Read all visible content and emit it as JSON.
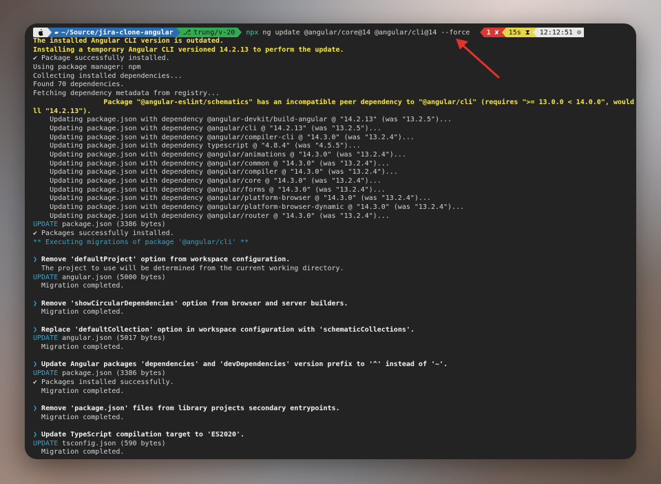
{
  "prompt": {
    "apple_icon": "",
    "folder_icon": "folder-icon",
    "dir": "~/Source/jira-clone-angular",
    "git_icon": "git-branch-icon",
    "branch": "trung/v-20",
    "cmd_npx": "npx",
    "cmd_rest": " ng update @angular/core@14 @angular/cli@14 --force"
  },
  "status": {
    "error": "1 ✘",
    "duration": "15s ⧗",
    "clock": "12:12:51 ⊙"
  },
  "lines": [
    {
      "t": "The installed Angular CLI version is outdated.",
      "c": "yellow bold"
    },
    {
      "t": "Installing a temporary Angular CLI versioned 14.2.13 to perform the update.",
      "c": "yellow bold"
    },
    {
      "t": "✔ Package successfully installed.",
      "c": ""
    },
    {
      "t": "Using package manager: npm",
      "c": ""
    },
    {
      "t": "Collecting installed dependencies...",
      "c": ""
    },
    {
      "t": "Found 70 dependencies.",
      "c": ""
    },
    {
      "t": "Fetching dependency metadata from registry...",
      "c": ""
    },
    {
      "t": "                 Package \"@angular-eslint/schematics\" has an incompatible peer dependency to \"@angular/cli\" (requires \">= 13.0.0 < 14.0.0\", would inst",
      "c": "yellow bold"
    },
    {
      "t": "ll \"14.2.13\").",
      "c": "yellow bold"
    },
    {
      "t": "    Updating package.json with dependency @angular-devkit/build-angular @ \"14.2.13\" (was \"13.2.5\")...",
      "c": ""
    },
    {
      "t": "    Updating package.json with dependency @angular/cli @ \"14.2.13\" (was \"13.2.5\")...",
      "c": ""
    },
    {
      "t": "    Updating package.json with dependency @angular/compiler-cli @ \"14.3.0\" (was \"13.2.4\")...",
      "c": ""
    },
    {
      "t": "    Updating package.json with dependency typescript @ \"4.8.4\" (was \"4.5.5\")...",
      "c": ""
    },
    {
      "t": "    Updating package.json with dependency @angular/animations @ \"14.3.0\" (was \"13.2.4\")...",
      "c": ""
    },
    {
      "t": "    Updating package.json with dependency @angular/common @ \"14.3.0\" (was \"13.2.4\")...",
      "c": ""
    },
    {
      "t": "    Updating package.json with dependency @angular/compiler @ \"14.3.0\" (was \"13.2.4\")...",
      "c": ""
    },
    {
      "t": "    Updating package.json with dependency @angular/core @ \"14.3.0\" (was \"13.2.4\")...",
      "c": ""
    },
    {
      "t": "    Updating package.json with dependency @angular/forms @ \"14.3.0\" (was \"13.2.4\")...",
      "c": ""
    },
    {
      "t": "    Updating package.json with dependency @angular/platform-browser @ \"14.3.0\" (was \"13.2.4\")...",
      "c": ""
    },
    {
      "t": "    Updating package.json with dependency @angular/platform-browser-dynamic @ \"14.3.0\" (was \"13.2.4\")...",
      "c": ""
    },
    {
      "t": "    Updating package.json with dependency @angular/router @ \"14.3.0\" (was \"13.2.4\")...",
      "c": ""
    },
    {
      "t": "UPDATE package.json (3386 bytes)",
      "c": "",
      "cy": "UPDATE"
    },
    {
      "t": "✔ Packages successfully installed.",
      "c": ""
    },
    {
      "t": "** Executing migrations of package '@angular/cli' **",
      "c": "cyan"
    },
    {
      "t": "",
      "c": ""
    },
    {
      "t": "❯ Remove 'defaultProject' option from workspace configuration.",
      "c": "white bold",
      "arrow": true
    },
    {
      "t": "  The project to use will be determined from the current working directory.",
      "c": ""
    },
    {
      "t": "UPDATE angular.json (5000 bytes)",
      "c": "",
      "cy": "UPDATE"
    },
    {
      "t": "  Migration completed.",
      "c": ""
    },
    {
      "t": "",
      "c": ""
    },
    {
      "t": "❯ Remove 'showCircularDependencies' option from browser and server builders.",
      "c": "white bold",
      "arrow": true
    },
    {
      "t": "  Migration completed.",
      "c": ""
    },
    {
      "t": "",
      "c": ""
    },
    {
      "t": "❯ Replace 'defaultCollection' option in workspace configuration with 'schematicCollections'.",
      "c": "white bold",
      "arrow": true
    },
    {
      "t": "UPDATE angular.json (5017 bytes)",
      "c": "",
      "cy": "UPDATE"
    },
    {
      "t": "  Migration completed.",
      "c": ""
    },
    {
      "t": "",
      "c": ""
    },
    {
      "t": "❯ Update Angular packages 'dependencies' and 'devDependencies' version prefix to '^' instead of '~'.",
      "c": "white bold",
      "arrow": true
    },
    {
      "t": "UPDATE package.json (3386 bytes)",
      "c": "",
      "cy": "UPDATE"
    },
    {
      "t": "✔ Packages installed successfully.",
      "c": ""
    },
    {
      "t": "  Migration completed.",
      "c": ""
    },
    {
      "t": "",
      "c": ""
    },
    {
      "t": "❯ Remove 'package.json' files from library projects secondary entrypoints.",
      "c": "white bold",
      "arrow": true
    },
    {
      "t": "  Migration completed.",
      "c": ""
    },
    {
      "t": "",
      "c": ""
    },
    {
      "t": "❯ Update TypeScript compilation target to 'ES2020'.",
      "c": "white bold",
      "arrow": true
    },
    {
      "t": "UPDATE tsconfig.json (590 bytes)",
      "c": "",
      "cy": "UPDATE"
    },
    {
      "t": "  Migration completed.",
      "c": ""
    }
  ]
}
